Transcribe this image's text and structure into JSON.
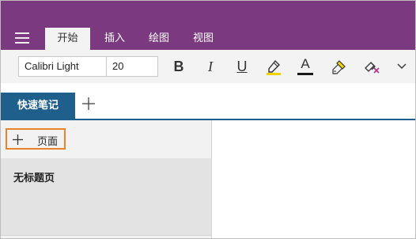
{
  "menu": {
    "tabs": [
      {
        "label": "开始"
      },
      {
        "label": "插入"
      },
      {
        "label": "绘图"
      },
      {
        "label": "视图"
      }
    ]
  },
  "ribbon": {
    "font_name": "Calibri Light",
    "font_size": "20",
    "bold_label": "B",
    "italic_label": "I",
    "underline_label": "U",
    "font_color_label": "A",
    "highlight_color": "#f2d400",
    "font_color": "#1a1a1a"
  },
  "section": {
    "tab_label": "快速笔记"
  },
  "pages": {
    "add_label": "页面",
    "items": [
      {
        "title": "无标题页"
      }
    ]
  },
  "colors": {
    "brand": "#7b3a7f",
    "section_accent": "#1f5f8b",
    "add_page_border": "#e8832a"
  }
}
